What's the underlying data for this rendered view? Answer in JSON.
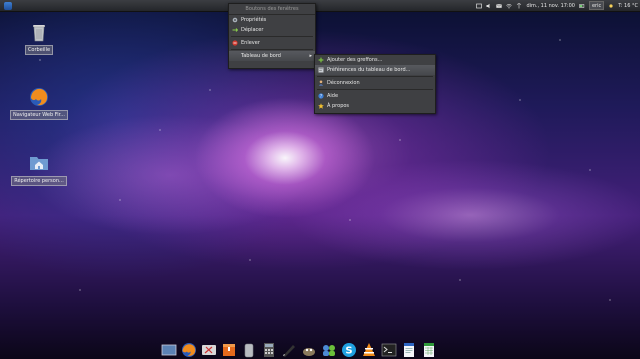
{
  "panel": {
    "datetime": "dim., 11 nov. 17:00",
    "user": "eric",
    "weather": "T: 16 °C"
  },
  "desktop_icons": [
    {
      "label": "Corbeille",
      "icon": "trash-icon"
    },
    {
      "label": "Navigateur Web Fir...",
      "icon": "firefox-icon"
    },
    {
      "label": "Répertoire person...",
      "icon": "home-folder-icon"
    }
  ],
  "context_menu": {
    "title": "Boutons des fenêtres",
    "items": [
      {
        "label": "Propriétés",
        "icon": "gear-icon"
      },
      {
        "label": "Déplacer",
        "icon": "move-icon"
      },
      {
        "label": "Enlever",
        "icon": "remove-icon"
      },
      {
        "label": "Tableau de bord",
        "icon": ""
      }
    ]
  },
  "submenu": {
    "items": [
      {
        "label": "Ajouter des greffons...",
        "icon": "plus-icon"
      },
      {
        "label": "Préférences du tableau de bord...",
        "icon": "preferences-icon"
      },
      {
        "label": "Déconnexion",
        "icon": "logout-icon"
      },
      {
        "label": "Aide",
        "icon": "help-icon"
      },
      {
        "label": "À propos",
        "icon": "about-star-icon"
      }
    ]
  },
  "dock_items": [
    "desktop-icon",
    "firefox-icon",
    "settings-tools-icon",
    "archive-icon",
    "trash-can-icon",
    "calculator-icon",
    "text-editor-icon",
    "gimp-icon",
    "messenger-icon",
    "skype-icon",
    "vlc-icon",
    "terminal-icon",
    "document-icon",
    "spreadsheet-icon"
  ],
  "colors": {
    "menu_bg": "#3f4043",
    "menu_highlight": "#57595e",
    "panel_bg": "#2d2f33"
  }
}
